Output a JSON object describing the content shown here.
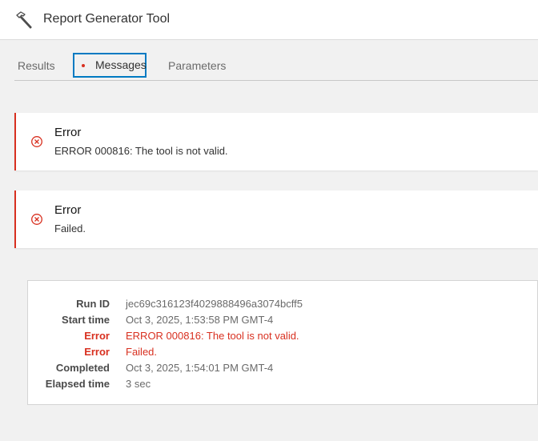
{
  "header": {
    "title": "Report Generator Tool",
    "icon": "hammer-icon"
  },
  "tabs": [
    {
      "label": "Results"
    },
    {
      "label": "Messages",
      "badge": "error-dot"
    },
    {
      "label": "Parameters"
    }
  ],
  "messages": [
    {
      "title": "Error",
      "text": "ERROR 000816: The tool is not valid.",
      "icon": "error-circle-x-icon"
    },
    {
      "title": "Error",
      "text": "Failed.",
      "icon": "error-circle-x-icon"
    }
  ],
  "summary": {
    "rows": [
      {
        "key": "Run ID",
        "value": "jec69c316123f4029888496a3074bcff5"
      },
      {
        "key": "Start time",
        "value": "Oct 3, 2025, 1:53:58 PM GMT-4"
      },
      {
        "key": "Error",
        "value": "ERROR 000816: The tool is not valid."
      },
      {
        "key": "Error",
        "value": "Failed."
      },
      {
        "key": "Completed",
        "value": "Oct 3, 2025, 1:54:01 PM GMT-4"
      },
      {
        "key": "Elapsed time",
        "value": "3 sec"
      }
    ]
  },
  "colors": {
    "accent": "#007ac2",
    "error": "#d83020"
  }
}
